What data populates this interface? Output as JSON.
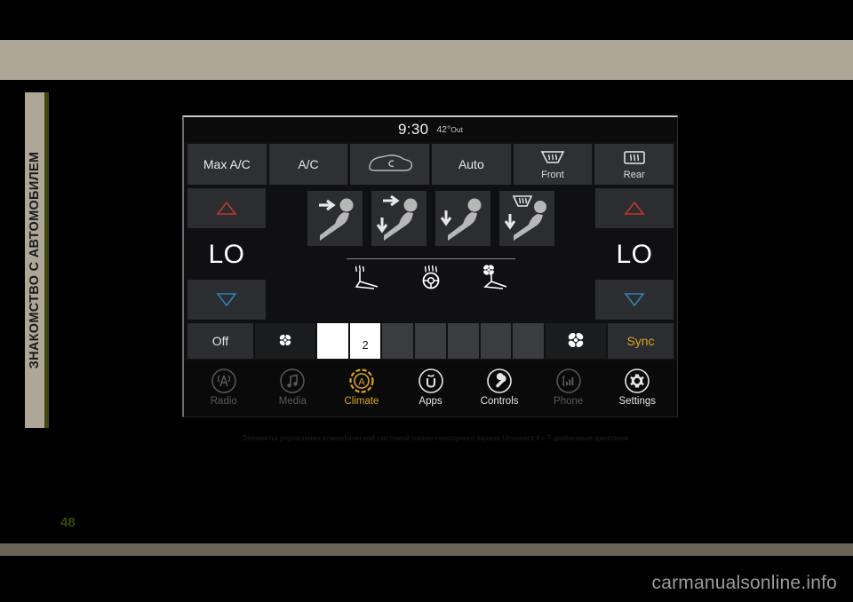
{
  "page": {
    "chapter_tab": "ЗНАКОМСТВО С АВТОМОБИЛЕМ",
    "page_number": "48",
    "watermark": "carmanualsonline.info",
    "caption": "Элементы управления климатической системой полно-сенсорного экрана Uconnect 4 с 7-дюймовым дисплеем",
    "colors": {
      "tab_bg": "#aea798",
      "tab_rule": "#3d4a0c",
      "page_num": "#394a08",
      "accent_gold": "#d9a520",
      "hot_red": "#c0392b",
      "cold_blue": "#2f81b7"
    }
  },
  "headunit": {
    "statusbar": {
      "clock": "9:30",
      "out_temp": "42°",
      "out_label": "Out"
    },
    "top_row": [
      {
        "label": "Max A/C",
        "icon": "max-ac-icon"
      },
      {
        "label": "A/C",
        "icon": "ac-icon"
      },
      {
        "label": "",
        "icon": "recirculation-icon"
      },
      {
        "label": "Auto",
        "icon": "auto-icon"
      },
      {
        "label": "Front",
        "icon": "front-defrost-icon"
      },
      {
        "label": "Rear",
        "icon": "rear-defrost-icon"
      }
    ],
    "temp_left": {
      "value": "LO",
      "up_icon": "temp-up-triangle-icon",
      "down_icon": "temp-down-triangle-icon"
    },
    "temp_right": {
      "value": "LO",
      "up_icon": "temp-up-triangle-icon",
      "down_icon": "temp-down-triangle-icon"
    },
    "airflow_modes": [
      {
        "name": "face-airflow-mode"
      },
      {
        "name": "face-and-floor-airflow-mode"
      },
      {
        "name": "floor-airflow-mode"
      },
      {
        "name": "floor-and-defrost-airflow-mode"
      }
    ],
    "comfort_row": [
      {
        "name": "heated-seat-icon"
      },
      {
        "name": "heated-steering-wheel-icon"
      },
      {
        "name": "ventilated-seat-icon"
      }
    ],
    "fan_row": {
      "off_label": "Off",
      "fan_down_icon": "fan-small-icon",
      "fan_up_icon": "fan-large-icon",
      "sync_label": "Sync",
      "level_label": "2",
      "level": 2,
      "total_bars": 7
    },
    "nav": [
      {
        "label": "Radio",
        "icon": "radio-tower-icon",
        "state": "dim"
      },
      {
        "label": "Media",
        "icon": "music-note-icon",
        "state": "dim"
      },
      {
        "label": "Climate",
        "icon": "climate-auto-icon",
        "state": "active"
      },
      {
        "label": "Apps",
        "icon": "uconnect-apps-icon",
        "state": "normal"
      },
      {
        "label": "Controls",
        "icon": "wrench-icon",
        "state": "normal"
      },
      {
        "label": "Phone",
        "icon": "phone-signal-icon",
        "state": "dim"
      },
      {
        "label": "Settings",
        "icon": "gear-icon",
        "state": "normal"
      }
    ]
  }
}
